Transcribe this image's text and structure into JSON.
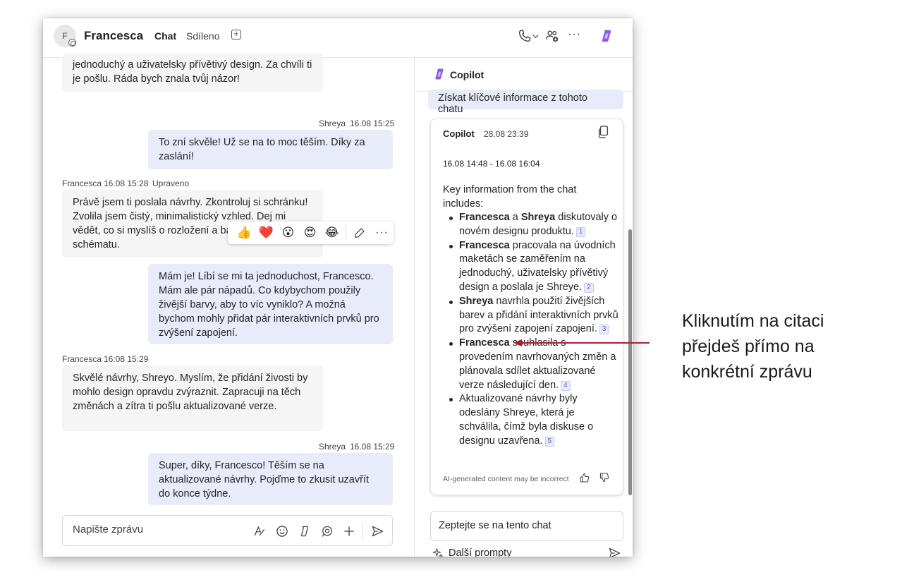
{
  "header": {
    "avatar_initial": "F",
    "contact_name": "Francesca",
    "tabs": [
      {
        "label": "Chat",
        "active": true
      },
      {
        "label": "Sdíleno",
        "active": false
      }
    ],
    "icons": [
      "phone-icon",
      "people-add-icon",
      "more-icon",
      "copilot-icon"
    ]
  },
  "chat": {
    "messages": [
      {
        "sender": "",
        "time": "",
        "edited": "",
        "direction": "in",
        "text": "jednoduchý a uživatelsky přívětivý design. Za chvíli ti je pošlu. Ráda bych znala tvůj názor!"
      },
      {
        "sender": "Shreya",
        "time": "16.08 15:25",
        "edited": "",
        "direction": "out",
        "text": "To zní skvěle! Už se na to moc těším. Díky za zaslání!"
      },
      {
        "sender": "Francesca",
        "time": "16.08 15:28",
        "edited": "Upraveno",
        "direction": "in",
        "text": "Právě jsem ti poslala návrhy. Zkontroluj si schránku! Zvolila jsem čistý, minimalistický vzhled. Dej mi vědět, co si myslíš o rozložení a barevném schématu."
      },
      {
        "sender": "",
        "time": "",
        "edited": "",
        "direction": "out",
        "text": "Mám je! Líbí se mi ta jednoduchost, Francesco. Mám ale pár nápadů. Co kdybychom použily živější barvy, aby to víc vyniklo? A možná bychom mohly přidat pár interaktivních prvků pro zvýšení zapojení."
      },
      {
        "sender": "Francesca",
        "time": "16:08 15:29",
        "edited": "",
        "direction": "in",
        "text": "Skvělé návrhy, Shreyo. Myslím, že přidání živosti by mohlo design opravdu zvýraznit. Zapracuji na těch změnách a zítra ti pošlu aktualizované verze."
      },
      {
        "sender": "Shreya",
        "time": "16.08 15:29",
        "edited": "",
        "direction": "out",
        "text": "Super, díky, Francesco! Těším se na aktualizované návrhy. Pojďme to zkusit uzavřít do konce týdne."
      }
    ],
    "reactions": [
      "👍",
      "❤️",
      "😮",
      "😍",
      "😂"
    ],
    "composer_placeholder": "Napište zprávu"
  },
  "copilot": {
    "title": "Copilot",
    "prompt_chip": "Získat klíčové informace z tohoto chatu",
    "card": {
      "author": "Copilot",
      "time": "28.08 23:39",
      "range": "16.08 14:48 - 16.08 16:04",
      "intro": "Key information from the chat includes:",
      "items": [
        {
          "bold": "Francesca",
          "mid": " a ",
          "bold2": "Shreya",
          "rest": " diskutovaly o novém designu produktu.",
          "cite": "1"
        },
        {
          "bold": "Francesca",
          "mid": "",
          "bold2": "",
          "rest": " pracovala na úvodních maketách se zaměřením na jednoduchý, uživatelsky přívětivý design a poslala je Shreye.",
          "cite": "2"
        },
        {
          "bold": "Shreya",
          "mid": "",
          "bold2": "",
          "rest": " navrhla použití živějších barev a přidání interaktivních prvků pro zvýšení zapojení zapojení.",
          "cite": "3"
        },
        {
          "bold": "Francesca",
          "mid": "",
          "bold2": "",
          "rest": " souhlasila s provedením navrhovaných změn a plánovala sdílet aktualizované verze následující den.",
          "cite": "4"
        },
        {
          "bold": "",
          "mid": "",
          "bold2": "",
          "rest": "Aktualizované návrhy byly odeslány Shreye, která je schválila, čímž byla diskuse o designu uzavřena.",
          "cite": "5"
        }
      ],
      "footer": "AI-generated content may be incorrect"
    },
    "ask_placeholder": "Zeptejte se na tento chat",
    "more_prompts": "Další prompty"
  },
  "annotation": {
    "text": "Kliknutím na citaci přejdeš přímo na konkrétní zprávu",
    "color": "#a4262c"
  }
}
